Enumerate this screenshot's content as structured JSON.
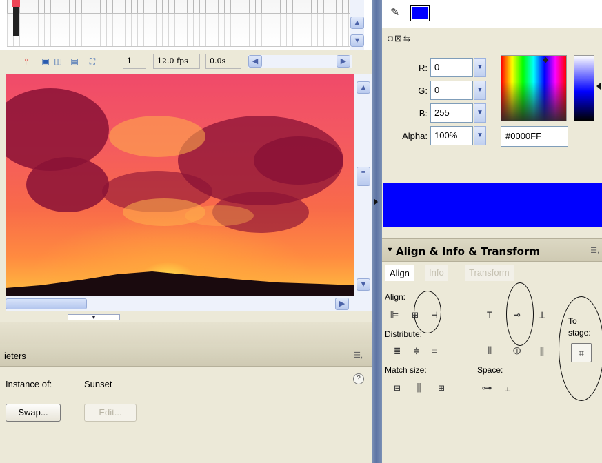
{
  "timeline": {
    "frame_number": "1",
    "fps": "12.0 fps",
    "elapsed": "0.0s"
  },
  "properties": {
    "panel_title": "ieters",
    "instance_label": "Instance of:",
    "instance_value": "Sunset",
    "swap_button": "Swap...",
    "edit_button": "Edit..."
  },
  "color_mixer": {
    "r_label": "R:",
    "r_value": "0",
    "g_label": "G:",
    "g_value": "0",
    "b_label": "B:",
    "b_value": "255",
    "alpha_label": "Alpha:",
    "alpha_value": "100%",
    "hex_value": "#0000FF",
    "fill_color": "#0000FF"
  },
  "align_panel": {
    "title": "Align & Info & Transform",
    "tabs": [
      "Align",
      "Info",
      "Transform"
    ],
    "active_tab": "Align",
    "align_label": "Align:",
    "distribute_label": "Distribute:",
    "match_size_label": "Match size:",
    "space_label": "Space:",
    "to_stage_label_1": "To",
    "to_stage_label_2": "stage:"
  },
  "icons": {
    "align": [
      "align-left-edge-icon",
      "align-horizontal-center-icon",
      "align-right-edge-icon",
      "align-top-edge-icon",
      "align-vertical-center-icon",
      "align-bottom-edge-icon"
    ],
    "distribute": [
      "distribute-top-icon",
      "distribute-vertical-center-icon",
      "distribute-bottom-icon",
      "distribute-left-icon",
      "distribute-horizontal-center-icon",
      "distribute-right-icon"
    ],
    "match_size": [
      "match-width-icon",
      "match-height-icon",
      "match-width-height-icon"
    ],
    "space": [
      "space-vertical-icon",
      "space-horizontal-icon"
    ]
  }
}
